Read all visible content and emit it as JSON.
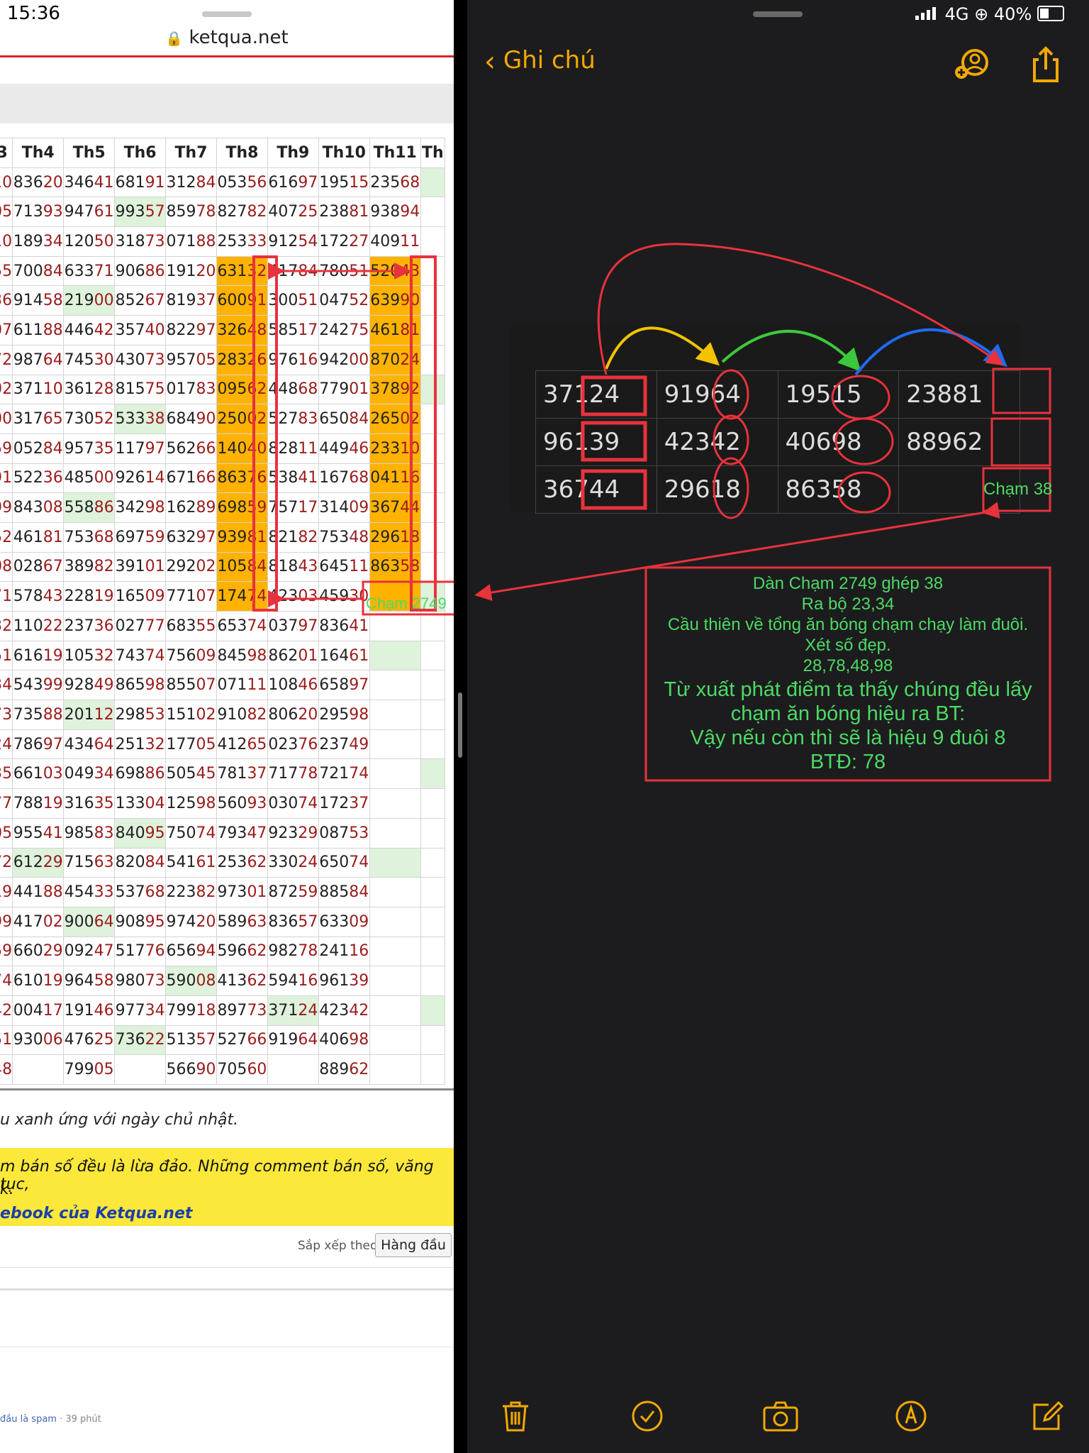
{
  "browser": {
    "time": "15:36",
    "url": "ketqua.net",
    "headers": [
      "3",
      "Th4",
      "Th5",
      "Th6",
      "Th7",
      "Th8",
      "Th9",
      "Th10",
      "Th11",
      "Th"
    ],
    "rows": [
      [
        "10",
        "83620",
        "34641",
        "68191",
        "31284",
        "05356",
        "61697",
        "19515",
        "23568",
        ""
      ],
      [
        "05",
        "71393",
        "94761",
        "99357",
        "85978",
        "82782",
        "40725",
        "23881",
        "93894",
        ""
      ],
      [
        "10",
        "18934",
        "12050",
        "31873",
        "07188",
        "25333",
        "91254",
        "17227",
        "40911",
        ""
      ],
      [
        "55",
        "70084",
        "63371",
        "90686",
        "19120",
        "63132",
        "41784",
        "78051",
        "52043",
        ""
      ],
      [
        "36",
        "91458",
        "21900",
        "85267",
        "81937",
        "60091",
        "30051",
        "04752",
        "63990",
        ""
      ],
      [
        "07",
        "61188",
        "44642",
        "35740",
        "82297",
        "32648",
        "58517",
        "24275",
        "46181",
        ""
      ],
      [
        "72",
        "98764",
        "74530",
        "43073",
        "95705",
        "28326",
        "97616",
        "94200",
        "87024",
        ""
      ],
      [
        "02",
        "37110",
        "36128",
        "81575",
        "01783",
        "09562",
        "44868",
        "77901",
        "37892",
        ""
      ],
      [
        "00",
        "31765",
        "73052",
        "53338",
        "68490",
        "25002",
        "52783",
        "65084",
        "26502",
        ""
      ],
      [
        "59",
        "05284",
        "95735",
        "11797",
        "56266",
        "14040",
        "82811",
        "44946",
        "23310",
        ""
      ],
      [
        "91",
        "52236",
        "48500",
        "92614",
        "67166",
        "86376",
        "53841",
        "16768",
        "04116",
        ""
      ],
      [
        "99",
        "84308",
        "55886",
        "34298",
        "16289",
        "69859",
        "75717",
        "31409",
        "36744",
        ""
      ],
      [
        "52",
        "46181",
        "75368",
        "69759",
        "63297",
        "93981",
        "82182",
        "75348",
        "29618",
        ""
      ],
      [
        "08",
        "02867",
        "38982",
        "39101",
        "29202",
        "10584",
        "81843",
        "64511",
        "86358",
        ""
      ],
      [
        "71",
        "57843",
        "22819",
        "16509",
        "77107",
        "17474",
        "42303",
        "45930",
        "",
        ""
      ],
      [
        "32",
        "11022",
        "23736",
        "02777",
        "68355",
        "65374",
        "03797",
        "83641",
        "",
        ""
      ],
      [
        "51",
        "61619",
        "10532",
        "74374",
        "75609",
        "84598",
        "86201",
        "16461",
        "",
        ""
      ],
      [
        "34",
        "54399",
        "92849",
        "86598",
        "85507",
        "07111",
        "10846",
        "65897",
        "",
        ""
      ],
      [
        "73",
        "73588",
        "20112",
        "29853",
        "15102",
        "91082",
        "80620",
        "29598",
        "",
        ""
      ],
      [
        "24",
        "78697",
        "43464",
        "25132",
        "17705",
        "41265",
        "02376",
        "23749",
        "",
        ""
      ],
      [
        "35",
        "66103",
        "04934",
        "69886",
        "50545",
        "78137",
        "71778",
        "72174",
        "",
        ""
      ],
      [
        "77",
        "78819",
        "31635",
        "13304",
        "12598",
        "56093",
        "03074",
        "17237",
        "",
        ""
      ],
      [
        "05",
        "95541",
        "98583",
        "84095",
        "75074",
        "79347",
        "92329",
        "08753",
        "",
        ""
      ],
      [
        "72",
        "61229",
        "71563",
        "82084",
        "54161",
        "25362",
        "33024",
        "65074",
        "",
        ""
      ],
      [
        "19",
        "44188",
        "45433",
        "53768",
        "22382",
        "97301",
        "87259",
        "88584",
        "",
        ""
      ],
      [
        "99",
        "41702",
        "90064",
        "90895",
        "97420",
        "58963",
        "83657",
        "63309",
        "",
        ""
      ],
      [
        "59",
        "66029",
        "09247",
        "51776",
        "65694",
        "59662",
        "98278",
        "24116",
        "",
        ""
      ],
      [
        "74",
        "61019",
        "96458",
        "98073",
        "59008",
        "41362",
        "59416",
        "96139",
        "",
        ""
      ],
      [
        "42",
        "00417",
        "19146",
        "97734",
        "79918",
        "89773",
        "37124",
        "42342",
        "",
        ""
      ],
      [
        "51",
        "93006",
        "47625",
        "73622",
        "51357",
        "52766",
        "91964",
        "40698",
        "",
        ""
      ],
      [
        "48",
        "",
        "79905",
        "",
        "56690",
        "70560",
        "",
        "88962",
        "",
        ""
      ]
    ],
    "annot_cham": "Chạm 2749",
    "footnote": "u xanh ứng với ngày chủ nhật.",
    "warning_line1": "m bán số đều là lừa đảo. Những comment bán số, văng tục,",
    "warning_line2": "k.",
    "facebook_link": "ebook của Ketqua.net",
    "sort_label": "Sắp xếp theo",
    "sort_value": "Hàng đầu",
    "comment_meta_link": "đầu là spam",
    "comment_meta_time": " · 39 phút"
  },
  "status": {
    "signal": "4G",
    "battery": "40%"
  },
  "notes": {
    "back_label": "Ghi chú",
    "pic_rows": [
      [
        "37124",
        "91964",
        "19515",
        "23881"
      ],
      [
        "96139",
        "42342",
        "40698",
        "88962"
      ],
      [
        "36744",
        "29618",
        "86358",
        ""
      ]
    ],
    "cham_label": "Chạm 38",
    "box_lines": [
      "Dàn Chạm 2749 ghép 38",
      "Ra bộ 23,34",
      "Cầu thiên về tổng ăn bóng chạm chạy làm đuôi.",
      "Xét số đẹp.",
      "28,78,48,98",
      "Từ xuất phát điểm ta thấy chúng đều  lấy",
      "chạm ăn bóng hiệu ra BT:",
      "Vậy nếu còn thì sẽ là hiệu 9 đuôi 8",
      "BTĐ: 78"
    ],
    "accent": "#f2a900",
    "ink": "#e8323c",
    "green": "#4cd964"
  }
}
